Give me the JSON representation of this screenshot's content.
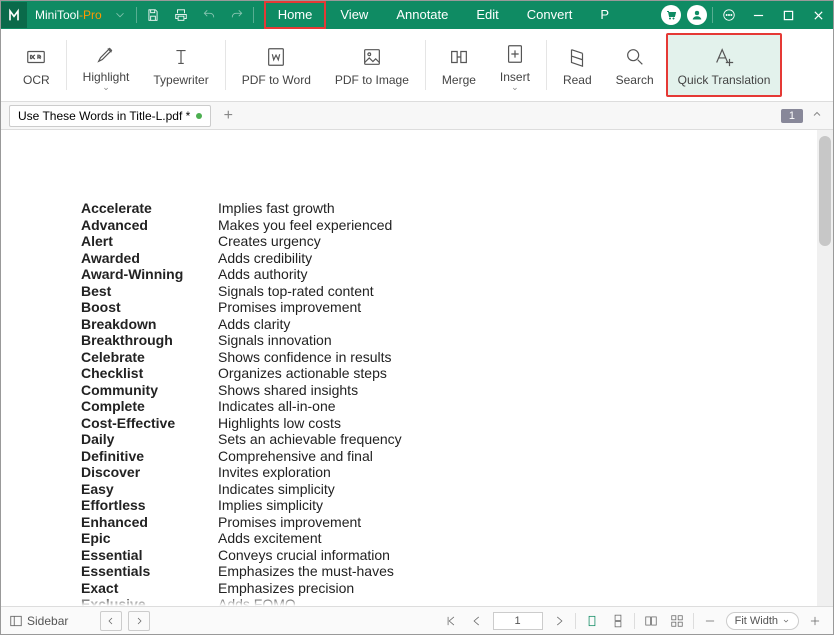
{
  "brand": {
    "name": "MiniTool",
    "suffix": "-Pro"
  },
  "menu": {
    "items": [
      "Home",
      "View",
      "Annotate",
      "Edit",
      "Convert",
      "P"
    ],
    "active": "Home"
  },
  "ribbon": {
    "ocr": "OCR",
    "highlight": "Highlight",
    "typewriter": "Typewriter",
    "pdf_to_word": "PDF to Word",
    "pdf_to_image": "PDF to Image",
    "merge": "Merge",
    "insert": "Insert",
    "read": "Read",
    "search": "Search",
    "quick_translation": "Quick Translation"
  },
  "tab": {
    "title": "Use These Words in Title-L.pdf *"
  },
  "page_indicator": "1",
  "doc": {
    "rows": [
      {
        "term": "Accelerate",
        "desc": "Implies fast growth"
      },
      {
        "term": "Advanced",
        "desc": "Makes you feel experienced"
      },
      {
        "term": "Alert",
        "desc": "Creates urgency"
      },
      {
        "term": "Awarded",
        "desc": "Adds credibility"
      },
      {
        "term": "Award-Winning",
        "desc": "Adds authority"
      },
      {
        "term": "Best",
        "desc": "Signals top-rated content"
      },
      {
        "term": "Boost",
        "desc": "Promises improvement"
      },
      {
        "term": "Breakdown",
        "desc": "Adds clarity"
      },
      {
        "term": "Breakthrough",
        "desc": "Signals innovation"
      },
      {
        "term": "Celebrate",
        "desc": "Shows confidence in results"
      },
      {
        "term": "Checklist",
        "desc": "Organizes actionable steps"
      },
      {
        "term": "Community",
        "desc": "Shows shared insights"
      },
      {
        "term": "Complete",
        "desc": "Indicates all-in-one"
      },
      {
        "term": "Cost-Effective",
        "desc": "Highlights low costs"
      },
      {
        "term": "Daily",
        "desc": "Sets an achievable frequency"
      },
      {
        "term": "Definitive",
        "desc": "Comprehensive and final"
      },
      {
        "term": "Discover",
        "desc": "Invites exploration"
      },
      {
        "term": "Easy",
        "desc": "Indicates simplicity"
      },
      {
        "term": "Effortless",
        "desc": "Implies simplicity"
      },
      {
        "term": "Enhanced",
        "desc": "Promises improvement"
      },
      {
        "term": "Epic",
        "desc": "Adds excitement"
      },
      {
        "term": "Essential",
        "desc": "Conveys crucial information"
      },
      {
        "term": "Essentials",
        "desc": "Emphasizes the must-haves"
      },
      {
        "term": "Exact",
        "desc": "Emphasizes precision"
      },
      {
        "term": "Exclusive",
        "desc": "Adds FOMO"
      }
    ]
  },
  "status": {
    "sidebar": "Sidebar",
    "page": "1",
    "zoom": "Fit Width"
  }
}
